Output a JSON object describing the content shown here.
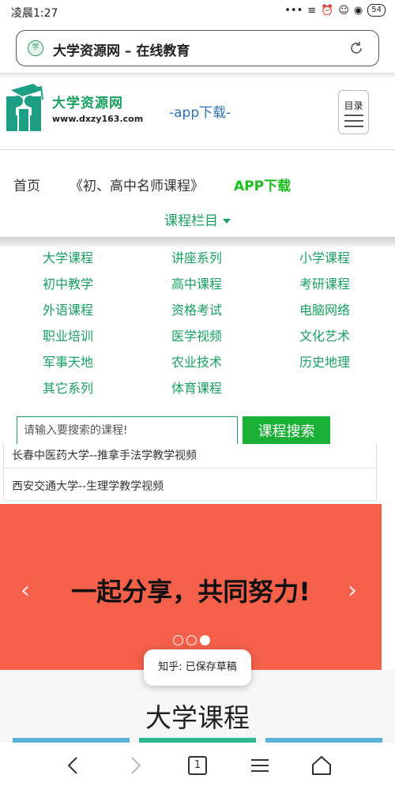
{
  "status": {
    "time": "凌晨1:27",
    "battery": "54"
  },
  "browser": {
    "page_title": "大学资源网 – 在线教育",
    "tab_count": "1"
  },
  "header": {
    "logo_name": "大学资源网",
    "logo_url": "www.dxzy163.com",
    "app_download": "-app下载-",
    "menu_label": "目录"
  },
  "nav": {
    "home": "首页",
    "courses": "《初、高中名师课程》",
    "app": "APP下载",
    "course_columns": "课程栏目"
  },
  "categories": [
    "大学课程",
    "讲座系列",
    "小学课程",
    "初中教学",
    "高中课程",
    "考研课程",
    "外语课程",
    "资格考试",
    "电脑网络",
    "职业培训",
    "医学视频",
    "文化艺术",
    "军事天地",
    "农业技术",
    "历史地理",
    "其它系列",
    "体育课程"
  ],
  "search": {
    "placeholder": "请输入要搜索的课程!",
    "button": "课程搜索"
  },
  "news": [
    "长春中医药大学--推拿手法学教学视频",
    "西安交通大学--生理学教学视频"
  ],
  "banner": {
    "text": "一起分享，共同努力!",
    "slides": 3,
    "active_slide": 3
  },
  "toast": "知乎: 已保存草稿",
  "section_title": "大学课程",
  "colors": {
    "accent_green": "#19a060",
    "button_green": "#19b035",
    "banner_red": "#f5604b",
    "link_blue": "#2e72b8"
  }
}
